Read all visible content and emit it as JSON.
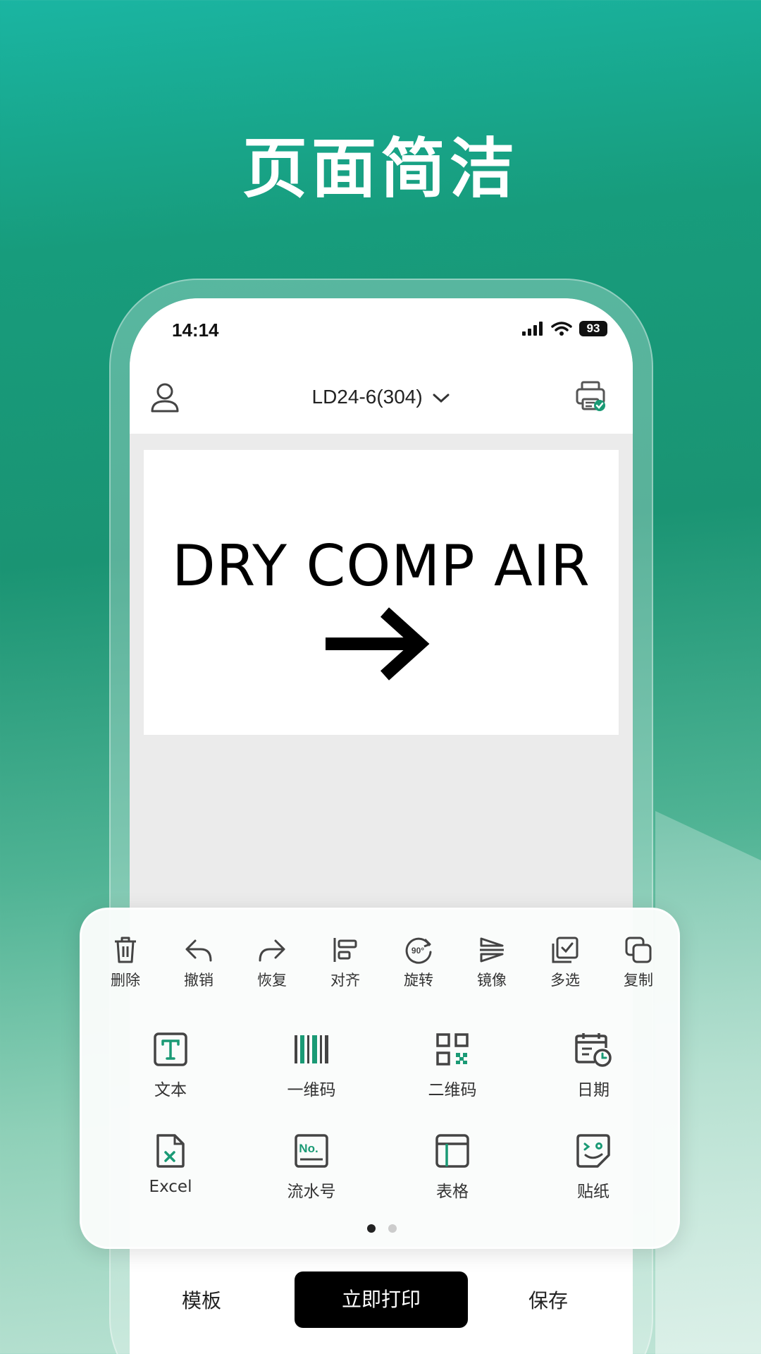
{
  "headline": "页面简洁",
  "status_bar": {
    "time": "14:14",
    "battery": "93"
  },
  "nav": {
    "device_name": "LD24-6(304)"
  },
  "label": {
    "text": "DRY COMP AIR",
    "icon": "right-arrow-icon"
  },
  "toolbar": {
    "tools": [
      {
        "label": "删除",
        "icon": "trash-icon"
      },
      {
        "label": "撤销",
        "icon": "undo-icon"
      },
      {
        "label": "恢复",
        "icon": "redo-icon"
      },
      {
        "label": "对齐",
        "icon": "align-icon"
      },
      {
        "label": "旋转",
        "icon": "rotate-90-icon"
      },
      {
        "label": "镜像",
        "icon": "mirror-icon"
      },
      {
        "label": "多选",
        "icon": "multi-select-icon"
      },
      {
        "label": "复制",
        "icon": "copy-icon"
      }
    ],
    "elements": [
      {
        "label": "文本",
        "icon": "text-icon"
      },
      {
        "label": "一维码",
        "icon": "barcode-icon"
      },
      {
        "label": "二维码",
        "icon": "qrcode-icon"
      },
      {
        "label": "日期",
        "icon": "date-icon"
      },
      {
        "label": "Excel",
        "icon": "excel-icon"
      },
      {
        "label": "流水号",
        "icon": "serial-number-icon"
      },
      {
        "label": "表格",
        "icon": "table-icon"
      },
      {
        "label": "贴纸",
        "icon": "sticker-icon"
      }
    ],
    "page_indicator": {
      "pages": 2,
      "active": 1
    }
  },
  "bottom_bar": {
    "template": "模板",
    "print": "立即打印",
    "save": "保存"
  },
  "colors": {
    "accent": "#1a9a75",
    "print_button": "#000000"
  }
}
